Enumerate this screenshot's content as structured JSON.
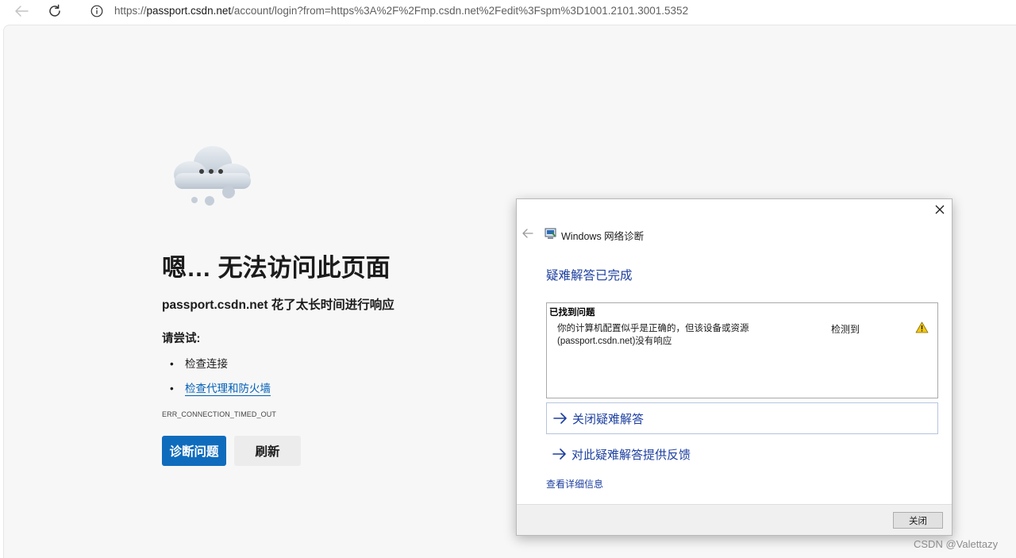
{
  "browser": {
    "url_scheme": "https://",
    "url_host": "passport.csdn.net",
    "url_path": "/account/login?from=https%3A%2F%2Fmp.csdn.net%2Fedit%3Fspm%3D1001.2101.3001.5352",
    "icons": {
      "back": "arrow-left-icon",
      "reload": "reload-icon",
      "info": "info-icon"
    }
  },
  "error_page": {
    "icon": "cloud-icon",
    "title": "嗯… 无法访问此页面",
    "subtitle": "passport.csdn.net 花了太长时间进行响应",
    "try_label": "请尝试:",
    "suggestions": [
      {
        "bullet": "•",
        "text": "检查连接",
        "is_link": false
      },
      {
        "bullet": "•",
        "text": "检查代理和防火墙",
        "is_link": true
      }
    ],
    "error_code": "ERR_CONNECTION_TIMED_OUT",
    "buttons": {
      "diagnose": "诊断问题",
      "refresh": "刷新"
    },
    "colors": {
      "accent": "#0f6cbd",
      "link": "#005fb8"
    }
  },
  "diagnostics_dialog": {
    "title": "Windows 网络诊断",
    "heading": "疑难解答已完成",
    "problem_box": {
      "header": "已找到问题",
      "description_line1": "你的计算机配置似乎是正确的，但该设备或资源",
      "description_line2": "(passport.csdn.net)没有响应",
      "status": "检测到",
      "status_icon": "warning-icon"
    },
    "links": {
      "close_troubleshooter": "关闭疑难解答",
      "give_feedback": "对此疑难解答提供反馈",
      "details": "查看详细信息"
    },
    "close_button": "关闭",
    "colors": {
      "link": "#1d3f9f",
      "warning": "#f2c811"
    }
  },
  "watermark": "CSDN @Valettazy"
}
